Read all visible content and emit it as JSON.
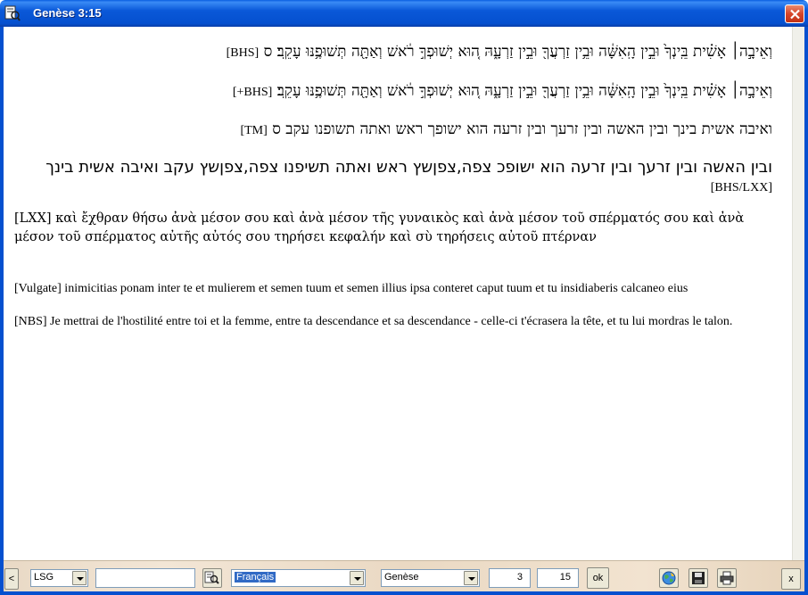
{
  "window": {
    "title": "Genèse 3:15"
  },
  "verses": {
    "bhs": {
      "text": "וְאֵיבָ֣ה׀ אָשִׁ֗ית בֵּֽינְךָ֙ וּבֵ֣ין הָֽאִשָּׁ֔ה וּבֵ֥ין זַרְעֲךָ֖ וּבֵ֣ין זַרְעָ֑הּ ה֚וּא יְשׁוּפְךָ֣ רֹ֔אשׁ וְאַתָּ֖ה תְּשׁוּפֶ֥נּוּ עָקֵֽב׃ ס",
      "tag": "[BHS]"
    },
    "bhs_plus": {
      "text": "וְאֵיבָ֣ה׀ אָשִׁ֗ית בֵּֽינְךָ֙ וּבֵ֣ין הָֽאִשָּׁ֔ה וּבֵ֥ין זַרְעֲךָ֖ וּבֵ֣ין זַרְעָ֑הּ ה֚וּא יְשׁוּפְךָ֣ רֹ֔אשׁ וְאַתָּ֖ה תְּשׁוּפֶ֥נּוּ עָקֵֽב׃",
      "tag": "[BHS+]"
    },
    "tm": {
      "text": "ואיבה אשית בינך ובין האשה ובין זרעך ובין זרעה הוא ישופך ראש ואתה תשופנו עקב ס",
      "tag": "[TM]"
    },
    "bhs_lxx": {
      "text": "ובין האשה ובין זרעך ובין זרעה הוא ישופכ צפה,צפןשץ ראש ואתה תשיפנו צפה,צפןשץ עקב ואיבה אשית בינך",
      "tag": "[BHS/LXX]"
    },
    "lxx": "[LXX] καὶ ἔχθραν θήσω ἀνὰ μέσον σου καὶ ἀνὰ μέσον τῆς γυναικὸς καὶ ἀνὰ μέσον τοῦ σπέρματός σου καὶ ἀνὰ μέσον τοῦ σπέρματος αὐτῆς αὐτός σου τηρήσει κεφαλήν καὶ σὺ τηρήσεις αὐτοῦ πτέρναν",
    "vulgate": "[Vulgate] inimicitias ponam inter te et mulierem et semen tuum et semen illius ipsa conteret caput tuum et tu insidiaberis calcaneo eius",
    "nbs": "[NBS] Je mettrai de l'hostilité entre toi et la femme, entre ta descendance et sa descendance - celle-ci t'écrasera la tête, et tu lui mordras le talon."
  },
  "toolbar": {
    "prev_label": "<",
    "version_select": "LSG",
    "search_value": "",
    "language_select": "Français",
    "book_select": "Genèse",
    "chapter_value": "3",
    "verse_value": "15",
    "ok_label": "ok",
    "close_label": "x"
  }
}
